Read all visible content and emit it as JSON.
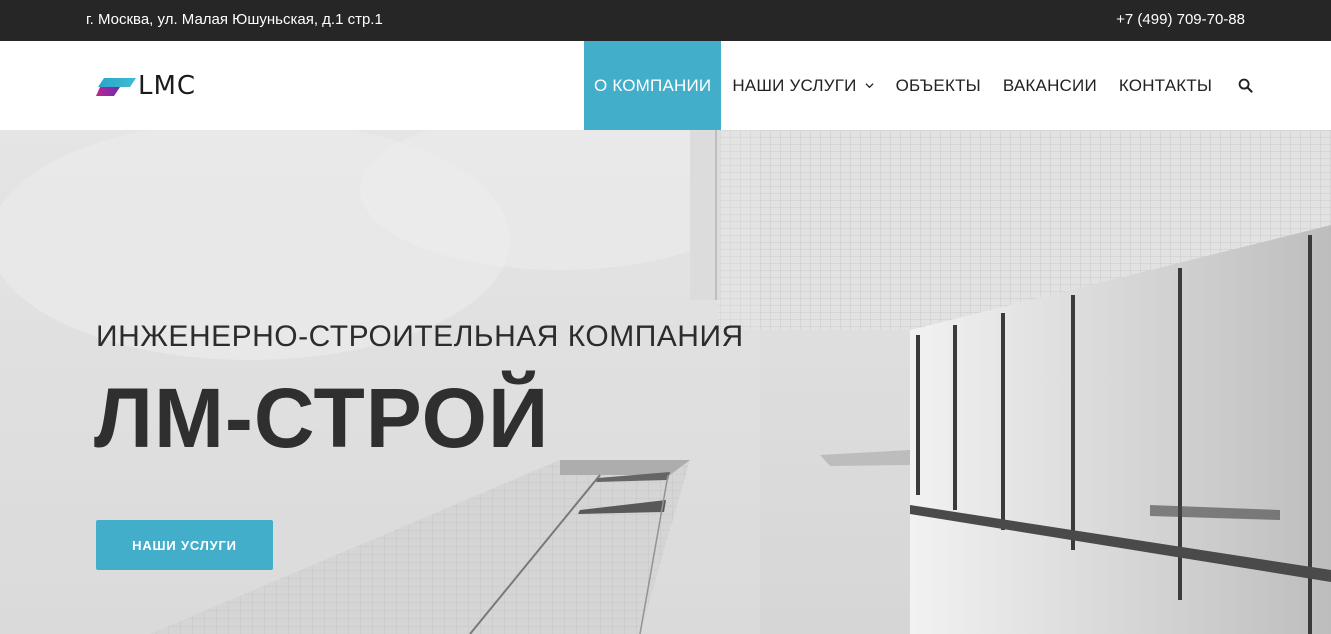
{
  "topbar": {
    "address": "г. Москва, ул. Малая Юшуньская, д.1 стр.1",
    "phone": "+7 (499) 709-70-88"
  },
  "header": {
    "logo_text": "LMC",
    "nav": [
      {
        "label": "О КОМПАНИИ",
        "active": true
      },
      {
        "label": "НАШИ УСЛУГИ",
        "has_dropdown": true
      },
      {
        "label": "ОБЪЕКТЫ"
      },
      {
        "label": "ВАКАНСИИ"
      },
      {
        "label": "КОНТАКТЫ"
      }
    ],
    "search_icon": "search-icon"
  },
  "hero": {
    "subtitle": "ИНЖЕНЕРНО-СТРОИТЕЛЬНАЯ КОМПАНИЯ",
    "title": "ЛМ-СТРОЙ",
    "button_label": "НАШИ УСЛУГИ"
  },
  "colors": {
    "accent": "#42aec9",
    "topbar_bg": "#262626",
    "text_dark": "#2f2f2f"
  }
}
